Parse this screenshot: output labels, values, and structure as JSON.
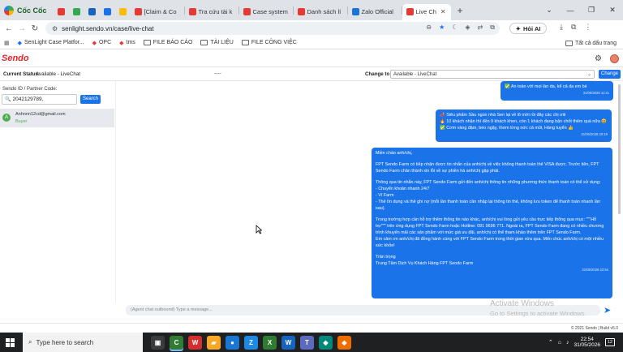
{
  "browser": {
    "brand": "Cốc Cốc",
    "tabs": [
      {
        "title": "",
        "favicon_color": "#e53935",
        "icon": "gmail-icon"
      },
      {
        "title": "",
        "favicon_color": "#34a853",
        "icon": "sheets-icon"
      },
      {
        "title": "",
        "favicon_color": "#1565c0",
        "icon": "app-icon"
      },
      {
        "title": "",
        "favicon_color": "#1a73e8",
        "icon": "meet-icon"
      },
      {
        "title": "",
        "favicon_color": "#fbbc04",
        "icon": "drive-icon"
      },
      {
        "title": "[Claim & Co",
        "favicon_color": "#e53935"
      },
      {
        "title": "Tra cứu tài k",
        "favicon_color": "#e53935"
      },
      {
        "title": "Case system",
        "favicon_color": "#e53935"
      },
      {
        "title": "Danh sách lí",
        "favicon_color": "#e53935"
      },
      {
        "title": "Zalo Official",
        "favicon_color": "#1976d2"
      },
      {
        "title": "Live Ch",
        "favicon_color": "#e53935",
        "active": true
      }
    ],
    "url": "senlight.sendo.vn/case/live-chat",
    "ai_button": "Hỏi AI",
    "bookmarks": [
      "SenLight Case Platfor...",
      "OPC",
      "tms",
      "FILE BÁO CÁO",
      "TÀI LIỆU",
      "FILE CÔNG VIỆC"
    ],
    "all_bookmarks": "Tất cả dấu trang"
  },
  "app": {
    "logo": "Sendo",
    "status_label": "Current Status:",
    "status_value": "Available - LiveChat",
    "dashes": "----",
    "change_label": "Change to",
    "change_selected": "Available - LiveChat",
    "change_button": "Change",
    "search_label": "Sendo ID / Partner Code:",
    "search_value": "2042129789,",
    "search_button": "Search",
    "contact": {
      "initial": "A",
      "email": "Anhnnn12cd@gmail.com",
      "sub": "Buyer"
    },
    "messages": [
      {
        "lines": [
          "✅ An toàn với mọi làn da, kể cả da em bé"
        ],
        "time": "31/05/2026 11:21"
      },
      {
        "lines": [
          "📣 Siêu phẩm Sầu ngon nhà Sen lại về lô mới rồi đây các chị ơiii",
          "🔥 10 khách nhận thì đến 9 khách khen, còn 1 khách đang bận chốt thêm quà nữa 😆",
          "✅ Cơm vàng đậm, béo ngậy, thơm lừng nức cả mũi, Hàng tuyển 👍"
        ],
        "time": "31/05/2026 20:19"
      },
      {
        "lines": [
          "Miền chào anh/chị,",
          "",
          "FPT Sendo Farm có tiếp nhận được tin nhắn của anh/chị về việc không thanh toán thẻ VISA được. Trước tiên, FPT",
          "Sendo Farm chân thành xin lỗi về sự phiền hà anh/chị gặp phải.",
          "",
          "Thông qua tin nhắn này, FPT Sendo Farm gửi đến anh/chị thông tin những phương thức thanh toán có thể sử dụng:",
          "- Chuyển khoản nhanh 24/7",
          "- Ví Farm",
          "- Thẻ tín dụng và thẻ ghi nợ (mỗi lần thanh toán cần nhập lại thông tin thẻ, không lưu token để thanh toán nhanh lần",
          "sau).",
          "",
          "Trong trường hợp cần hỗ trợ thêm thông tin nào khác, anh/chị vui lòng gửi yêu cầu trực tiếp thông qua mục: \"\"\"Hỗ",
          "trợ\"\"\" trên ứng dụng FPT Sendo Farm hoặc Hotline: 091 9696 771. Ngoài ra, FPT Sendo Farm đang có nhiều chương",
          "trình khuyến mãi các sản phẩm với mức giá ưu đãi, anh/chị có thể tham khảo thêm trên FPT Sendo Farm.",
          "Em cảm ơn anh/chị đã đồng hành cùng với FPT Sendo Farm trong thời gian vừa qua. Mến chúc anh/chị có một nhiều",
          "sức khỏe!",
          "",
          "Trân trọng",
          "Trung Tâm Dịch Vụ Khách Hàng FPT Sendo Farm"
        ],
        "time": "31/05/2026 22:54"
      }
    ],
    "composer_placeholder": "(Agent chat outbound) Type a message...",
    "watermark_title": "Activate Windows",
    "watermark_sub": "Go to Settings to activate Windows.",
    "footer": "© 2021 Sendo | Build v5.0"
  },
  "taskbar": {
    "search_placeholder": "Type here to search",
    "apps": [
      {
        "icon": "task-view-icon",
        "color": "#3a3b3c",
        "glyph": "▣"
      },
      {
        "icon": "coccoc-browser-icon",
        "color": "#2e7d32",
        "glyph": "C",
        "active": true
      },
      {
        "icon": "wps-icon",
        "color": "#d32f2f",
        "glyph": "W"
      },
      {
        "icon": "file-explorer-icon",
        "color": "#f9a825",
        "glyph": "▰"
      },
      {
        "icon": "chrome-icon",
        "color": "#1976d2",
        "glyph": "●"
      },
      {
        "icon": "zalo-icon",
        "color": "#1e88e5",
        "glyph": "Z"
      },
      {
        "icon": "excel-icon",
        "color": "#2e7d32",
        "glyph": "X"
      },
      {
        "icon": "word-icon",
        "color": "#1565c0",
        "glyph": "W"
      },
      {
        "icon": "teams-icon",
        "color": "#5c6bc0",
        "glyph": "T"
      },
      {
        "icon": "app-icon",
        "color": "#00897b",
        "glyph": "◆"
      },
      {
        "icon": "app-icon",
        "color": "#ef6c00",
        "glyph": "◆"
      }
    ],
    "time": "22:54",
    "date": "31/05/2026",
    "notifications": "12"
  }
}
